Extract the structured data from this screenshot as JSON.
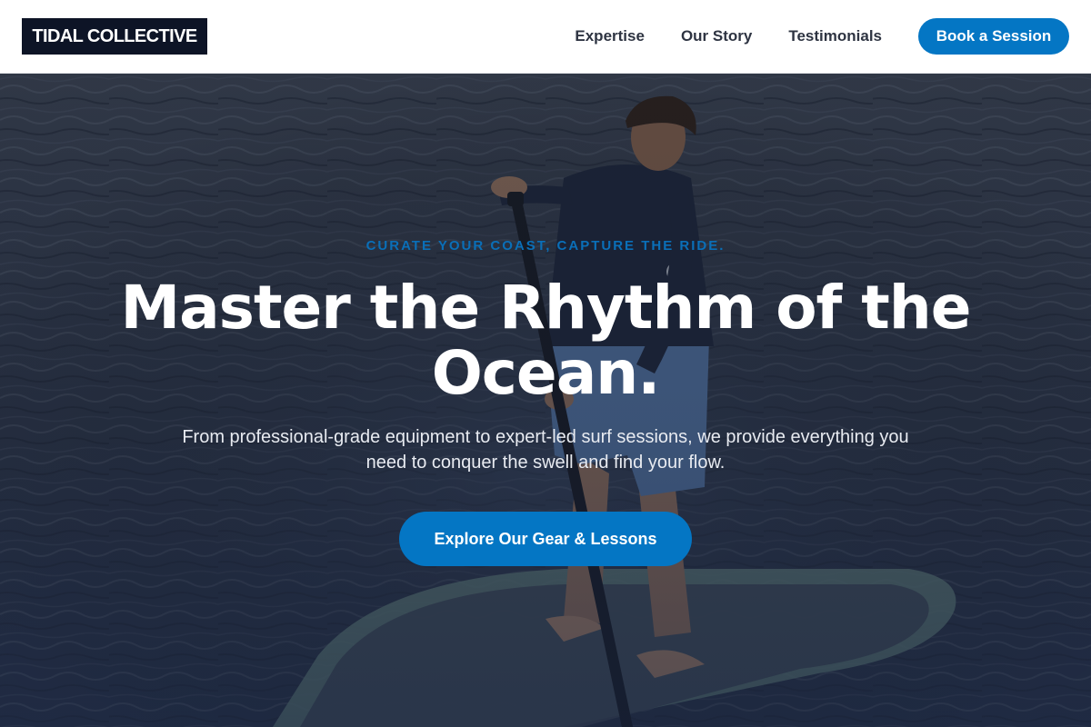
{
  "header": {
    "logo_text": "TIDAL COLLECTIVE",
    "nav": [
      {
        "label": "Expertise"
      },
      {
        "label": "Our Story"
      },
      {
        "label": "Testimonials"
      }
    ],
    "cta_label": "Book a Session"
  },
  "hero": {
    "eyebrow": "CURATE YOUR COAST, CAPTURE THE RIDE.",
    "headline": "Master the Rhythm of the Ocean.",
    "subtitle": "From professional-grade equipment to expert-led surf sessions, we provide everything you need to conquer the swell and find your flow.",
    "cta_label": "Explore Our Gear & Lessons",
    "background_image": "paddleboarder-on-ocean-photo"
  },
  "colors": {
    "accent": "#0476c4",
    "logo_bg": "#0d1426",
    "nav_text": "#2e3442",
    "eyebrow": "#0a6fb8",
    "ocean": "#2b3445"
  }
}
